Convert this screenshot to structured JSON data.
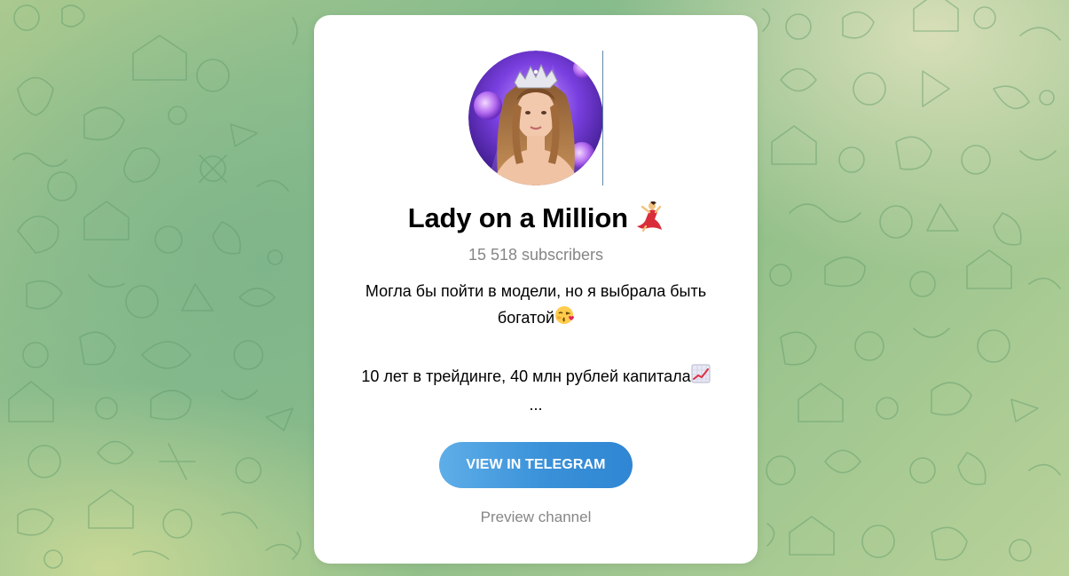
{
  "channel": {
    "title": "Lady on a Million",
    "title_emoji": "dancer-emoji-icon",
    "subscribers": "15 518 subscribers",
    "description_line1": "Могла бы пойти в модели, но я выбрала быть",
    "description_line2": "богатой",
    "description_line2_emoji": "kiss-face-emoji-icon",
    "description_line3": "10 лет в трейдинге, 40 млн рублей капитала",
    "description_line3_emoji": "chart-increasing-emoji-icon",
    "description_ellipsis": "..."
  },
  "actions": {
    "view_button_label": "VIEW IN TELEGRAM",
    "preview_label": "Preview channel"
  },
  "colors": {
    "button_gradient_start": "#5eaee8",
    "button_gradient_end": "#2f86d3",
    "secondary_text": "#868686",
    "background_green": "#86bb8c"
  }
}
